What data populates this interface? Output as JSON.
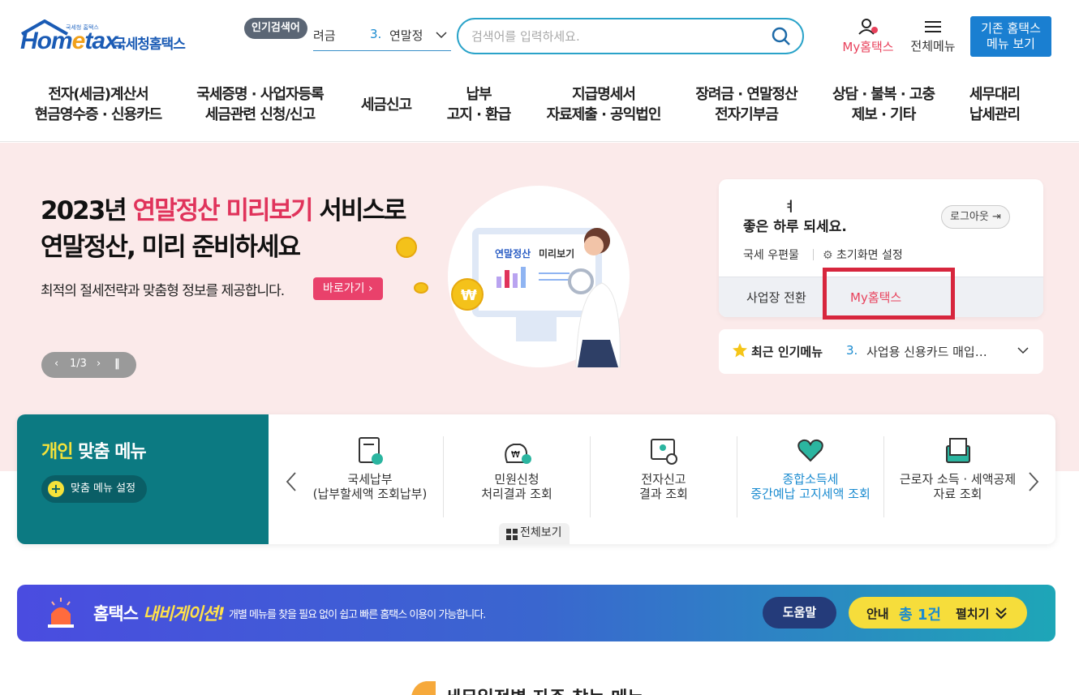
{
  "header": {
    "logo_small": "국세청 홈택스",
    "logo_word_pre": "Hom",
    "logo_word_e": "e",
    "logo_word_post": "tax.",
    "logo_kr": "국세청홈택스",
    "popular_badge": "인기검색어",
    "popular_prev": "려금",
    "popular_rank": "3.",
    "popular_text": "연말정",
    "search_placeholder": "검색어를 입력하세요.",
    "my_label": "My홈택스",
    "all_menu_label": "전체메뉴",
    "old_btn_line1": "기존 홈택스",
    "old_btn_line2": "메뉴 보기"
  },
  "gnb": [
    {
      "l1": "전자(세금)계산서",
      "l2": "현금영수증 · 신용카드"
    },
    {
      "l1": "국세증명 · 사업자등록",
      "l2": "세금관련 신청/신고"
    },
    {
      "l1": "세금신고",
      "l2": ""
    },
    {
      "l1": "납부",
      "l2": "고지 · 환급"
    },
    {
      "l1": "지급명세서",
      "l2": "자료제출 · 공익법인"
    },
    {
      "l1": "장려금 · 연말정산",
      "l2": "전자기부금"
    },
    {
      "l1": "상담 · 불복 · 고충",
      "l2": "제보 · 기타"
    },
    {
      "l1": "세무대리",
      "l2": "납세관리"
    }
  ],
  "hero": {
    "title_l1_pre": "2023년 ",
    "title_l1_pink": "연말정산 미리보기",
    "title_l1_post": " 서비스로",
    "title_l2": "연말정산, 미리 준비하세요",
    "sub": "최적의 절세전략과 맞춤형 정보를 제공합니다.",
    "go_btn": "바로가기",
    "pager_text": "1/3",
    "screen_title_a": "연말정산",
    "screen_title_b": " 미리보기",
    "coin_symbol": "₩"
  },
  "user_card": {
    "name": "ㅕ",
    "greeting": "좋은 하루 되세요.",
    "logout": "로그아웃",
    "mail": "국세 우편물",
    "home_setting": "초기화면 설정",
    "switch": "사업장 전환",
    "my_tab": "My홈택스"
  },
  "recent": {
    "title": "최근 인기메뉴",
    "rank": "3.",
    "text": "사업용 신용카드 매입…"
  },
  "custom_menu": {
    "title_y": "개인",
    "title_w": " 맞춤 메뉴",
    "setting": "맞춤 메뉴 설정",
    "all_view": "전체보기",
    "items": [
      {
        "l1": "국세납부",
        "l2": "(납부할세액 조회납부)"
      },
      {
        "l1": "민원신청",
        "l2": "처리결과 조회"
      },
      {
        "l1": "전자신고",
        "l2": "결과 조회"
      },
      {
        "l1": "종합소득세",
        "l2": "중간예납 고지세액 조회"
      },
      {
        "l1": "근로자 소득 · 세액공제",
        "l2": "자료 조회"
      }
    ]
  },
  "navi": {
    "t1_a": "홈택스 ",
    "t1_b": "내비게이션!",
    "t2": "개별 메뉴를 찾을 필요 없이 쉽고 빠른 홈택스 이용이 가능합니다.",
    "help": "도움말",
    "notice_a": "안내",
    "notice_b": "총 1건",
    "notice_c": "펼치기"
  },
  "bottom_title": "세무일정별 자주 찾는 메뉴",
  "colors": {
    "accent_pink": "#e0335b",
    "brand_blue": "#1a7fd1",
    "teal": "#0c7a82",
    "highlight_red": "#d7263d"
  }
}
